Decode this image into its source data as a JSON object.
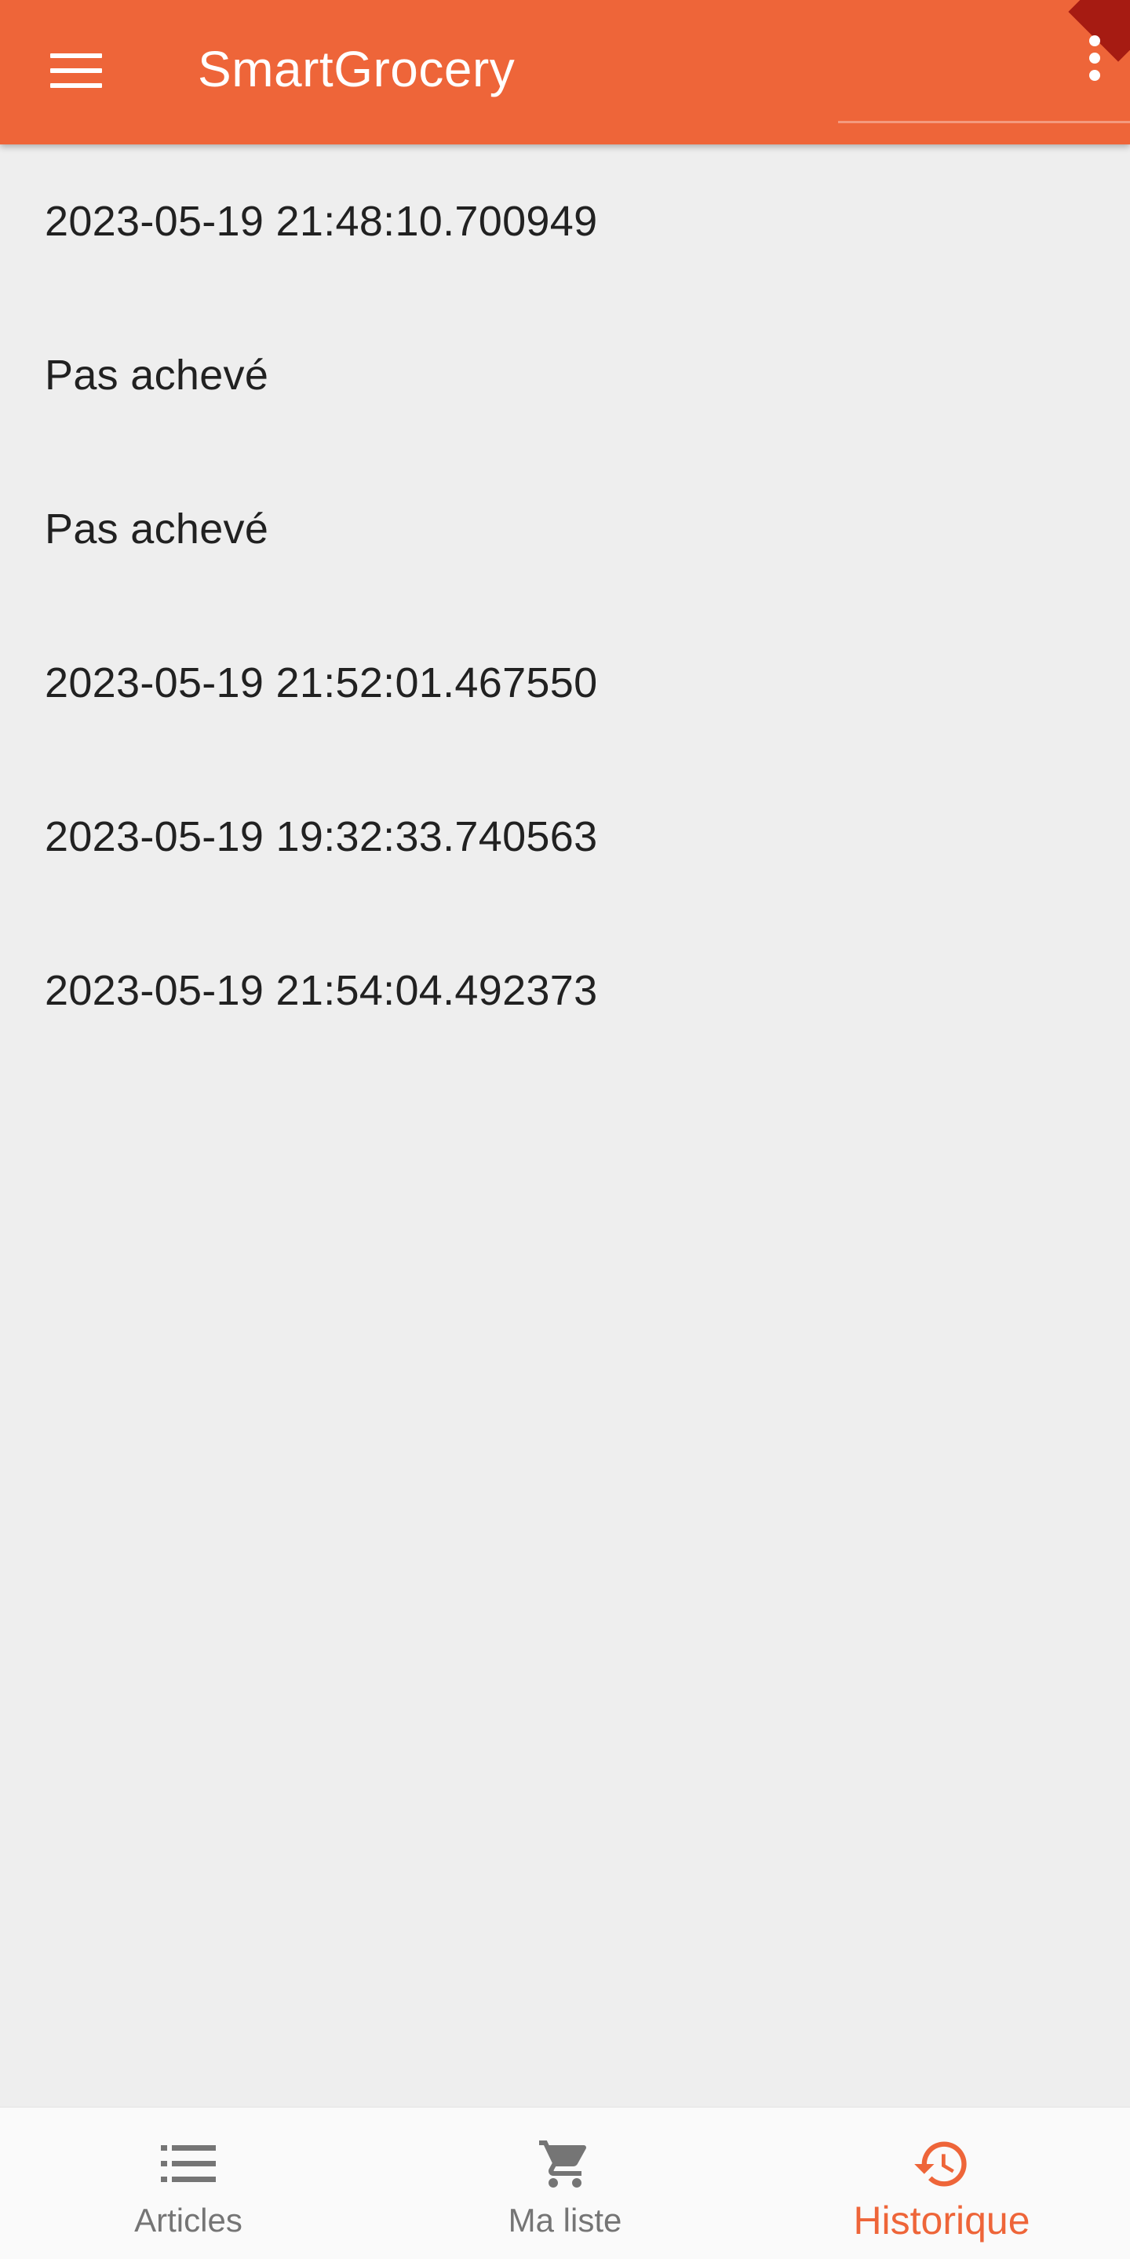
{
  "theme": {
    "primary": "#ee6539",
    "background": "#eeeeee",
    "text": "#212121",
    "nav_inactive": "#757575"
  },
  "appbar": {
    "title": "SmartGrocery",
    "menu_icon": "hamburger-menu-icon",
    "overflow_icon": "more-vert-icon"
  },
  "history": {
    "items": [
      {
        "label": "2023-05-19 21:48:10.700949"
      },
      {
        "label": "Pas achevé"
      },
      {
        "label": "Pas achevé"
      },
      {
        "label": "2023-05-19 21:52:01.467550"
      },
      {
        "label": "2023-05-19 19:32:33.740563"
      },
      {
        "label": "2023-05-19 21:54:04.492373"
      }
    ]
  },
  "bottom_nav": {
    "items": [
      {
        "label": "Articles",
        "icon": "list-icon",
        "active": false
      },
      {
        "label": "Ma liste",
        "icon": "shopping-cart-icon",
        "active": false
      },
      {
        "label": "Historique",
        "icon": "history-icon",
        "active": true
      }
    ]
  }
}
